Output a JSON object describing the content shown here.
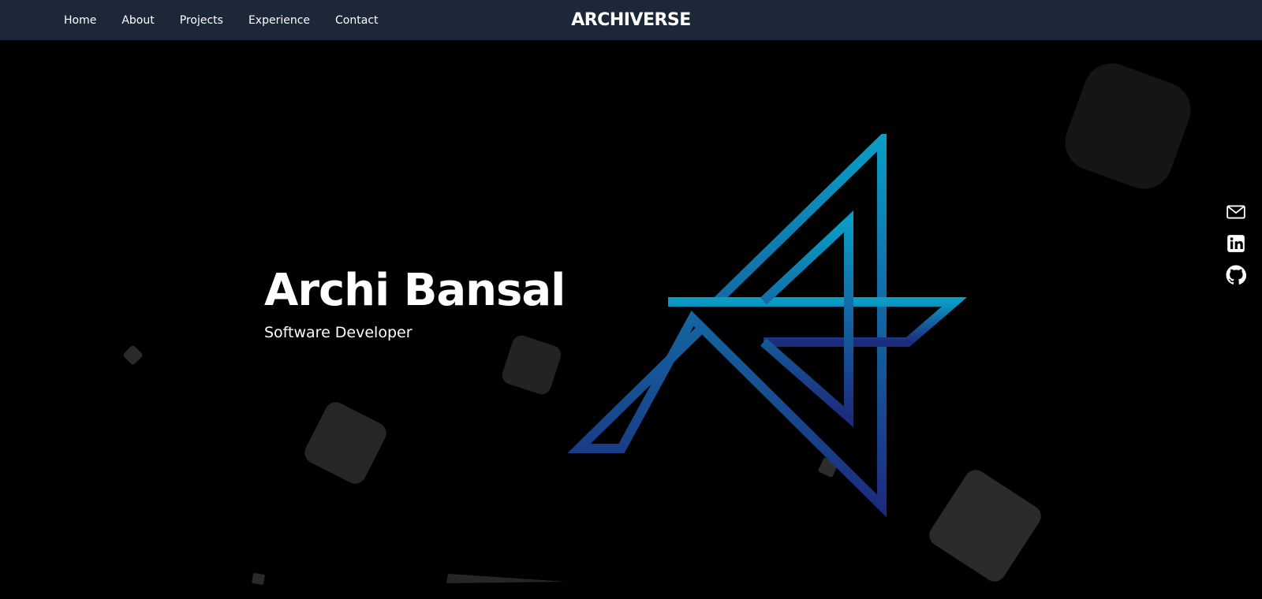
{
  "nav": {
    "links": [
      "Home",
      "About",
      "Projects",
      "Experience",
      "Contact"
    ],
    "brand": "ARCHIVERSE"
  },
  "hero": {
    "name": "Archi Bansal",
    "role": "Software Developer"
  },
  "social": {
    "icons": [
      "mail-icon",
      "linkedin-icon",
      "github-icon"
    ]
  },
  "colors": {
    "navbar": "#1c2837",
    "background": "#000000",
    "logo_gradient_start": "#0a9cc4",
    "logo_gradient_end": "#1c2c7c",
    "shape": "#262626"
  }
}
